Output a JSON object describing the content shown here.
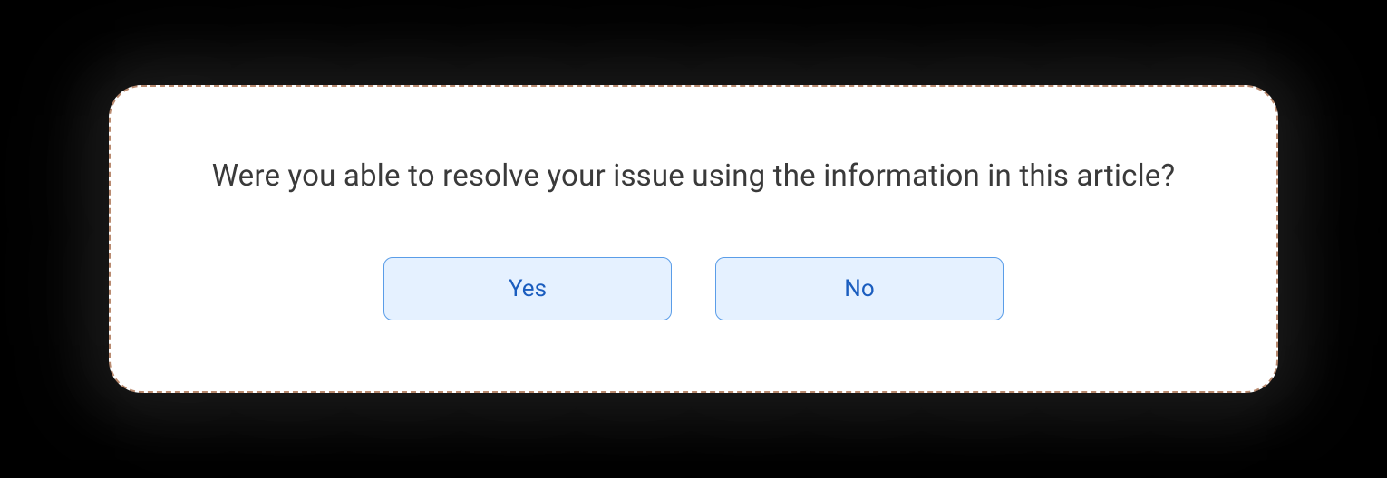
{
  "feedback": {
    "prompt": "Were you able to resolve your issue using the information in this article?",
    "yes_label": "Yes",
    "no_label": "No"
  }
}
